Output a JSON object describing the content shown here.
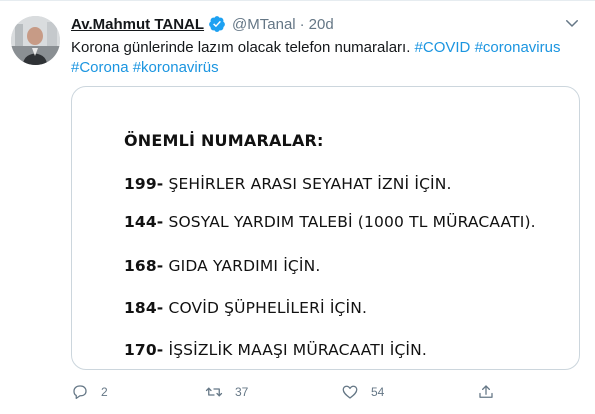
{
  "tweet": {
    "display_name": "Av.Mahmut TANAL",
    "handle": "@MTanal",
    "separator": "·",
    "time": "20d",
    "text_prefix": "Korona günlerinde lazım olacak telefon numaraları.",
    "hashtags": [
      "#COVID",
      "#coronavirus",
      "#Corona",
      "#koronavirüs"
    ]
  },
  "media": {
    "title": "ÖNEMLİ NUMARALAR:",
    "rows": [
      {
        "number": "199-",
        "text": "ŞEHİRLER ARASI SEYAHAT İZNİ İÇİN."
      },
      {
        "number": "144-",
        "text": "SOSYAL YARDIM TALEBİ (1000 TL MÜRACAATI)."
      },
      {
        "number": "168-",
        "text": "GIDA YARDIMI İÇİN."
      },
      {
        "number": "184-",
        "text": "COVİD ŞÜPHELİLERİ İÇİN."
      },
      {
        "number": "170-",
        "text": "İŞSİZLİK MAAŞI MÜRACAATI İÇİN."
      }
    ]
  },
  "actions": {
    "reply_count": "2",
    "retweet_count": "37",
    "like_count": "54"
  },
  "icons": {
    "verified": "verified-badge-icon",
    "caret": "chevron-down-icon",
    "reply": "reply-icon",
    "retweet": "retweet-icon",
    "like": "heart-icon",
    "share": "share-icon"
  },
  "colors": {
    "link": "#1b95e0",
    "secondary_text": "#657786",
    "verified": "#1da1f2"
  }
}
